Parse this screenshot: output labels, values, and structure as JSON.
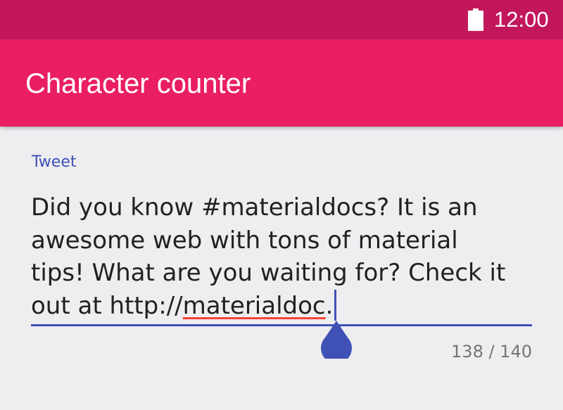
{
  "status_bar": {
    "time": "12:00",
    "battery_icon": "battery-icon",
    "color": "#c2185b"
  },
  "app_bar": {
    "title": "Character counter",
    "color": "#e91e63"
  },
  "tweet_field": {
    "label": "Tweet",
    "lines": [
      "Did you know #materialdocs? It is an",
      "awesome web with tons of material",
      "tips! What are you waiting for? Check it"
    ],
    "last_line_prefix": "out at http://",
    "misspelled_word": "materialdoc",
    "last_line_suffix": ".",
    "counter": "138 / 140",
    "accent_color": "#3f51b5",
    "spellcheck_color": "#f44336"
  }
}
